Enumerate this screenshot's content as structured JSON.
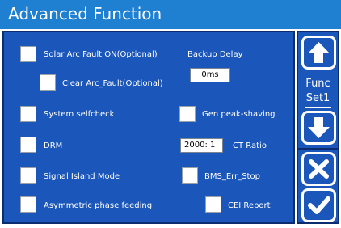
{
  "title": "Advanced Function",
  "options": {
    "solar_arc_fault": "Solar Arc Fault ON(Optional)",
    "clear_arc_fault": "Clear Arc_Fault(Optional)",
    "system_selfcheck": "System selfcheck",
    "drm": "DRM",
    "signal_island_mode": "Signal Island Mode",
    "asymmetric_phase_feeding": "Asymmetric phase feeding",
    "gen_peak_shaving": "Gen peak-shaving",
    "bms_err_stop": "BMS_Err_Stop",
    "cei_report": "CEI Report"
  },
  "backup_delay": {
    "label": "Backup Delay",
    "value": "0ms"
  },
  "ct_ratio": {
    "label": "CT Ratio",
    "value": "2000: 1"
  },
  "side": {
    "func_label_line1": "Func",
    "func_label_line2": "Set1",
    "up_icon": "arrow-up-icon",
    "down_icon": "arrow-down-icon",
    "cancel_icon": "close-icon",
    "confirm_icon": "check-icon"
  },
  "colors": {
    "title_bar": "#1f7fd0",
    "panel": "#1b56ba",
    "panel_border": "#0b2c6f",
    "text": "#ffffff"
  }
}
